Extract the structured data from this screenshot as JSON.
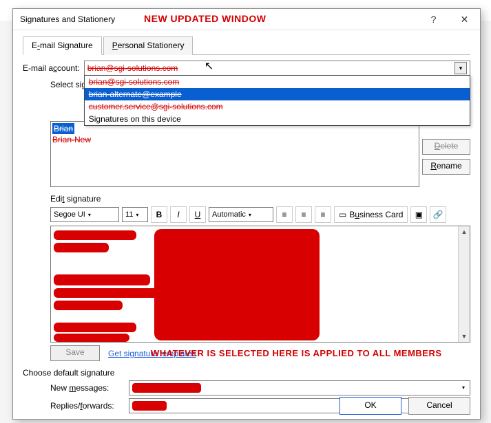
{
  "annotations": {
    "new_window": "NEW UPDATED WINDOW",
    "default_note": "WHATEVER IS SELECTED HERE IS APPLIED TO ALL MEMBERS"
  },
  "dialog": {
    "title": "Signatures and Stationery",
    "help_glyph": "?",
    "close_glyph": "✕"
  },
  "tabs": {
    "email": {
      "pre": "E",
      "accel": "-",
      "post": "mail Signature"
    },
    "personal": {
      "pre": "",
      "accel": "P",
      "post": "ersonal Stationery"
    }
  },
  "account": {
    "label_pre": "E-mail a",
    "label_accel": "c",
    "label_post": "count:",
    "selected": "brian@sgi-solutions.com",
    "options": [
      {
        "text": "brian@sgi-solutions.com",
        "kind": "red"
      },
      {
        "text": "brian-alternate@example",
        "kind": "red-sel"
      },
      {
        "text": "customer.service@sgi-solutions.com",
        "kind": "red"
      },
      {
        "text": "Signatures on this device",
        "kind": "plain"
      }
    ]
  },
  "siglist": {
    "label_pre": "Select signa",
    "label_rest": "ture to edit:",
    "items": [
      {
        "text": "Brian",
        "hl": true
      },
      {
        "text": "Brian-New",
        "hl": false
      }
    ]
  },
  "buttons": {
    "delete": {
      "accel": "D",
      "rest": "elete"
    },
    "rename": {
      "accel": "R",
      "rest": "ename"
    },
    "save": "Save",
    "ok": "OK",
    "cancel": "Cancel"
  },
  "edit": {
    "label_pre": "Edi",
    "label_accel": "t",
    "label_post": " signature",
    "font": "Segoe UI",
    "size": "11",
    "color": "Automatic",
    "bizcard_pre": "B",
    "bizcard_accel": "u",
    "bizcard_post": "siness Card"
  },
  "link_text": "Get signature templates",
  "defaults": {
    "section": "Choose default signature",
    "new_pre": "New ",
    "new_accel": "m",
    "new_post": "essages:",
    "rep_pre": "Replies/",
    "rep_accel": "f",
    "rep_post": "orwards:"
  },
  "icons": {
    "chev_down": "▾",
    "bold": "B",
    "italic": "I",
    "underline": "U",
    "align_left": "≡",
    "align_center": "≡",
    "align_right": "≡",
    "card": "▭",
    "image": "▣",
    "link": "🔗",
    "up": "▲",
    "down": "▼"
  }
}
